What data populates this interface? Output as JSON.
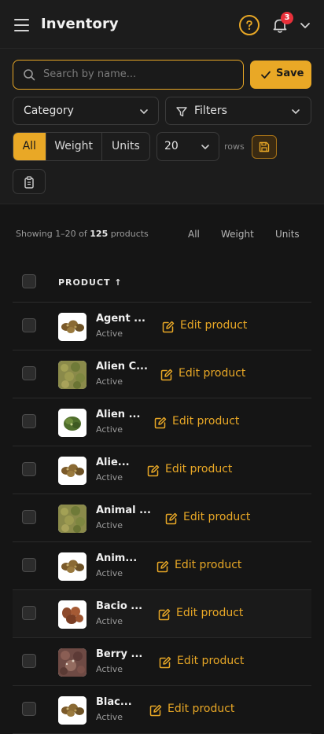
{
  "header": {
    "title": "Inventory",
    "notification_count": "3"
  },
  "toolbar": {
    "search_placeholder": "Search by name...",
    "save_label": "Save",
    "category_label": "Category",
    "filters_label": "Filters",
    "view_options": [
      "All",
      "Weight",
      "Units"
    ],
    "active_view": "All",
    "rows_value": "20",
    "rows_label": "rows"
  },
  "summary": {
    "prefix": "Showing 1–20 of ",
    "total": "125",
    "suffix": " products",
    "links": [
      "All",
      "Weight",
      "Units"
    ]
  },
  "table": {
    "header": "PRODUCT ↑",
    "edit_label": "Edit product",
    "rows": [
      {
        "name": "Agent ...",
        "status": "Active",
        "thumb": "buds-white"
      },
      {
        "name": "Alien C...",
        "status": "Active",
        "thumb": "green-ground"
      },
      {
        "name": "Alien ...",
        "status": "Active",
        "thumb": "green-bud"
      },
      {
        "name": "Alie...",
        "status": "Active",
        "thumb": "buds-white"
      },
      {
        "name": "Animal ...",
        "status": "Active",
        "thumb": "green-ground"
      },
      {
        "name": "Anim...",
        "status": "Active",
        "thumb": "buds-white"
      },
      {
        "name": "Bacio ...",
        "status": "Active",
        "thumb": "brown-buds"
      },
      {
        "name": "Berry ...",
        "status": "Active",
        "thumb": "purple-ground"
      },
      {
        "name": "Blac...",
        "status": "Active",
        "thumb": "buds-white"
      }
    ]
  },
  "colors": {
    "accent": "#e9a826",
    "badge": "#e8303a",
    "background": "#151515"
  }
}
